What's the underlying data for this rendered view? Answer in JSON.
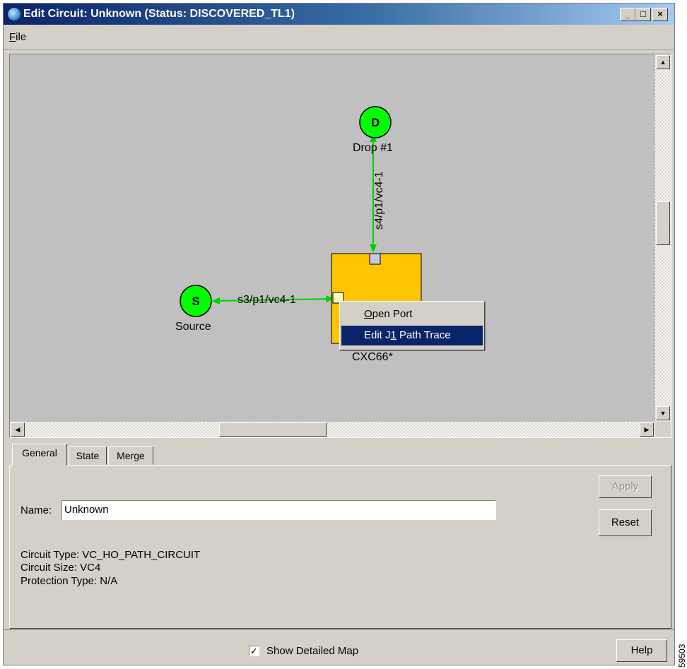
{
  "window": {
    "title": "Edit Circuit: Unknown (Status: DISCOVERED_TL1)",
    "icon": "circuit-app-icon",
    "controls": {
      "minimize": "_",
      "maximize": "□",
      "close": "×"
    }
  },
  "menu": {
    "file_label": "File",
    "file_accel": "F",
    "file_rest": "ile"
  },
  "diagram": {
    "drop_node": {
      "letter": "D",
      "label": "Drop #1"
    },
    "source_node": {
      "letter": "S",
      "label": "Source"
    },
    "switch_node": {
      "label": "CXC66*"
    },
    "vertical_link_label": "s4/p1/vc4-1",
    "horizontal_link_label": "s3/p1/vc4-1",
    "colors": {
      "node": "#00ff00",
      "switch": "#ffc400",
      "link": "#00d000",
      "port": "#c8c8e8"
    }
  },
  "context_menu": {
    "items": [
      {
        "label": "Open Port",
        "accel": "O",
        "rest": "pen Port",
        "highlighted": false
      },
      {
        "label": "Edit J1 Path Trace",
        "pre": "Edit J",
        "accel": "1",
        "rest": " Path Trace",
        "highlighted": true
      }
    ]
  },
  "tabs": [
    {
      "label": "General",
      "active": true
    },
    {
      "label": "State",
      "active": false
    },
    {
      "label": "Merge",
      "active": false
    }
  ],
  "general": {
    "name_label": "Name:",
    "name_value": "Unknown",
    "apply_label": "Apply",
    "reset_label": "Reset",
    "circuit_type": "Circuit Type:  VC_HO_PATH_CIRCUIT",
    "circuit_size": "Circuit Size: VC4",
    "protection_type": "Protection Type:  N/A"
  },
  "footer": {
    "show_detailed_map_label": "Show Detailed Map",
    "show_detailed_map_checked": true,
    "help_label": "Help"
  },
  "side_number": "59503"
}
